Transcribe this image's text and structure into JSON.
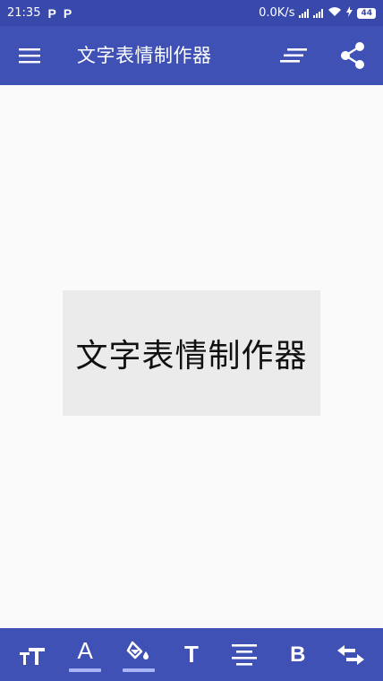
{
  "status_bar": {
    "time": "21:35",
    "notifications": [
      "P",
      "P"
    ],
    "net_speed": "0.0K/s",
    "battery": "44"
  },
  "app_bar": {
    "title": "文字表情制作器",
    "left_icon": "menu-icon",
    "right_icons": [
      "text-align-icon",
      "share-icon"
    ]
  },
  "preview": {
    "text": "文字表情制作器"
  },
  "bottom_toolbar": {
    "items": [
      {
        "icon": "text-size-icon"
      },
      {
        "icon": "text-color-icon",
        "label": "A",
        "underline_color": "#a9b4f5"
      },
      {
        "icon": "fill-color-icon",
        "underline_color": "#a9b4f5"
      },
      {
        "icon": "font-icon",
        "label": "T"
      },
      {
        "icon": "align-center-icon"
      },
      {
        "icon": "bold-icon",
        "label": "B"
      },
      {
        "icon": "swap-icon"
      }
    ]
  },
  "colors": {
    "primary": "#3f51b5",
    "status_bar": "#3949ab",
    "background": "#fafafa",
    "preview_bg": "#ebebeb"
  }
}
